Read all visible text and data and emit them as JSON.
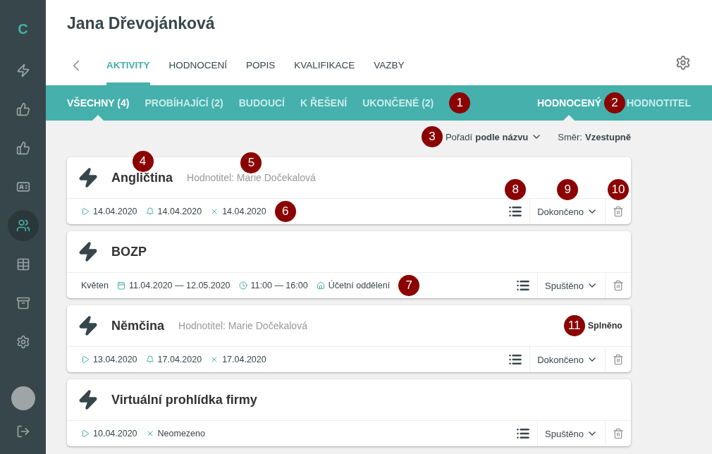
{
  "sidebar": {
    "logo": "C",
    "items": [
      {
        "kind": "bolt",
        "selected": false
      },
      {
        "kind": "thumb",
        "selected": false
      },
      {
        "kind": "thumb",
        "selected": false
      },
      {
        "kind": "card",
        "selected": false
      },
      {
        "kind": "users",
        "selected": true
      },
      {
        "kind": "table",
        "selected": false
      },
      {
        "kind": "archive",
        "selected": false
      },
      {
        "kind": "gear",
        "selected": false
      }
    ]
  },
  "person": {
    "name": "Jana Dřevojánková"
  },
  "tabs": [
    {
      "label": "AKTIVITY",
      "selected": true
    },
    {
      "label": "HODNOCENÍ",
      "selected": false
    },
    {
      "label": "POPIS",
      "selected": false
    },
    {
      "label": "KVALIFIKACE",
      "selected": false
    },
    {
      "label": "VAZBY",
      "selected": false
    }
  ],
  "filter_tabs": {
    "items": [
      {
        "label": "VŠECHNY (4)",
        "selected": true
      },
      {
        "label": "PROBÍHAJÍCÍ (2)",
        "selected": false
      },
      {
        "label": "BUDOUCÍ",
        "selected": false
      },
      {
        "label": "K ŘEŠENÍ",
        "selected": false
      },
      {
        "label": "UKONČENÉ (2)",
        "selected": false
      }
    ],
    "callout": "1"
  },
  "role_tabs": {
    "items": [
      {
        "label": "HODNOCENÝ",
        "selected": true
      },
      {
        "label": "HODNOTITEL",
        "selected": false
      }
    ],
    "callout": "2"
  },
  "sort": {
    "callout": "3",
    "label": "Pořadí",
    "value": "podle názvu",
    "direction_label": "Směr:",
    "direction": "Vzestupně"
  },
  "activities": [
    {
      "title": "Angličtina",
      "title_callout": "4",
      "evaluator": "Hodnotitel: Marie Dočekalová",
      "evaluator_callout": "5",
      "meta": [
        {
          "kind": "start",
          "text": "14.04.2020"
        },
        {
          "kind": "reminder",
          "text": "14.04.2020"
        },
        {
          "kind": "end",
          "text": "14.04.2020"
        }
      ],
      "meta_callout": "6",
      "status": "Dokončeno",
      "list_callout": "8",
      "status_callout": "9",
      "delete_callout": "10"
    },
    {
      "title": "BOZP",
      "meta": [
        {
          "kind": "text",
          "text": "Květen"
        },
        {
          "kind": "date_range",
          "text": "11.04.2020 — 12.05.2020"
        },
        {
          "kind": "time",
          "text": "11:00 — 16:00"
        },
        {
          "kind": "place",
          "text": "Účetní oddělení"
        }
      ],
      "meta_callout": "7",
      "status": "Spuštěno"
    },
    {
      "title": "Němčina",
      "evaluator": "Hodnotitel: Marie Dočekalová",
      "result": "Splněno",
      "result_callout": "11",
      "meta": [
        {
          "kind": "start",
          "text": "13.04.2020"
        },
        {
          "kind": "reminder",
          "text": "17.04.2020"
        },
        {
          "kind": "end",
          "text": "17.04.2020"
        }
      ],
      "status": "Dokončeno"
    },
    {
      "title": "Virtuální prohlídka firmy",
      "meta": [
        {
          "kind": "start",
          "text": "10.04.2020"
        },
        {
          "kind": "end",
          "text": "Neomezeno"
        }
      ],
      "status": "Spuštěno"
    }
  ]
}
